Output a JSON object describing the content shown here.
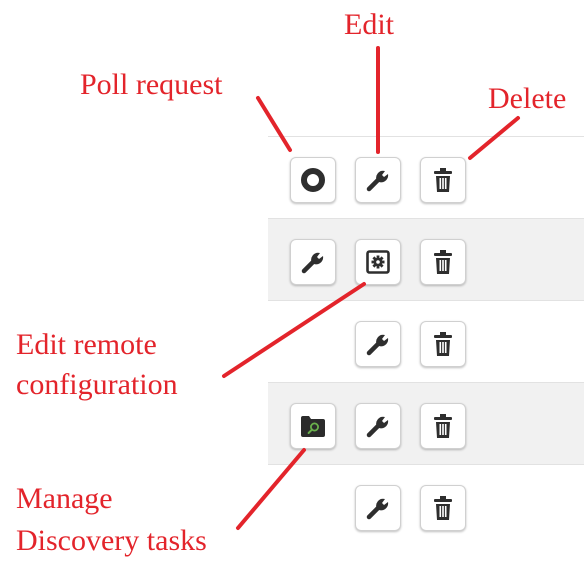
{
  "annotations": {
    "poll_request": "Poll request",
    "edit": "Edit",
    "delete": "Delete",
    "edit_remote_line1": "Edit remote",
    "edit_remote_line2": "configuration",
    "manage_line1": "Manage",
    "manage_line2": "Discovery tasks"
  },
  "rows": [
    {
      "actions": [
        "poll-request",
        "edit",
        "delete"
      ]
    },
    {
      "actions": [
        "edit",
        "edit-remote-configuration",
        "delete"
      ]
    },
    {
      "actions": [
        "edit",
        "delete"
      ]
    },
    {
      "actions": [
        "manage-discovery-tasks",
        "edit",
        "delete"
      ]
    },
    {
      "actions": [
        "edit",
        "delete"
      ]
    }
  ],
  "icons": {
    "poll_request": "ring-icon",
    "edit": "wrench-icon",
    "delete": "trash-icon",
    "edit_remote_configuration": "gear-box-icon",
    "manage_discovery_tasks": "folder-search-icon"
  },
  "colors": {
    "annotation_red": "#e3242b",
    "icon_dark": "#2e2e2e",
    "row_shade": "#f1f1f1",
    "discovery_accent": "#6ab04c"
  }
}
